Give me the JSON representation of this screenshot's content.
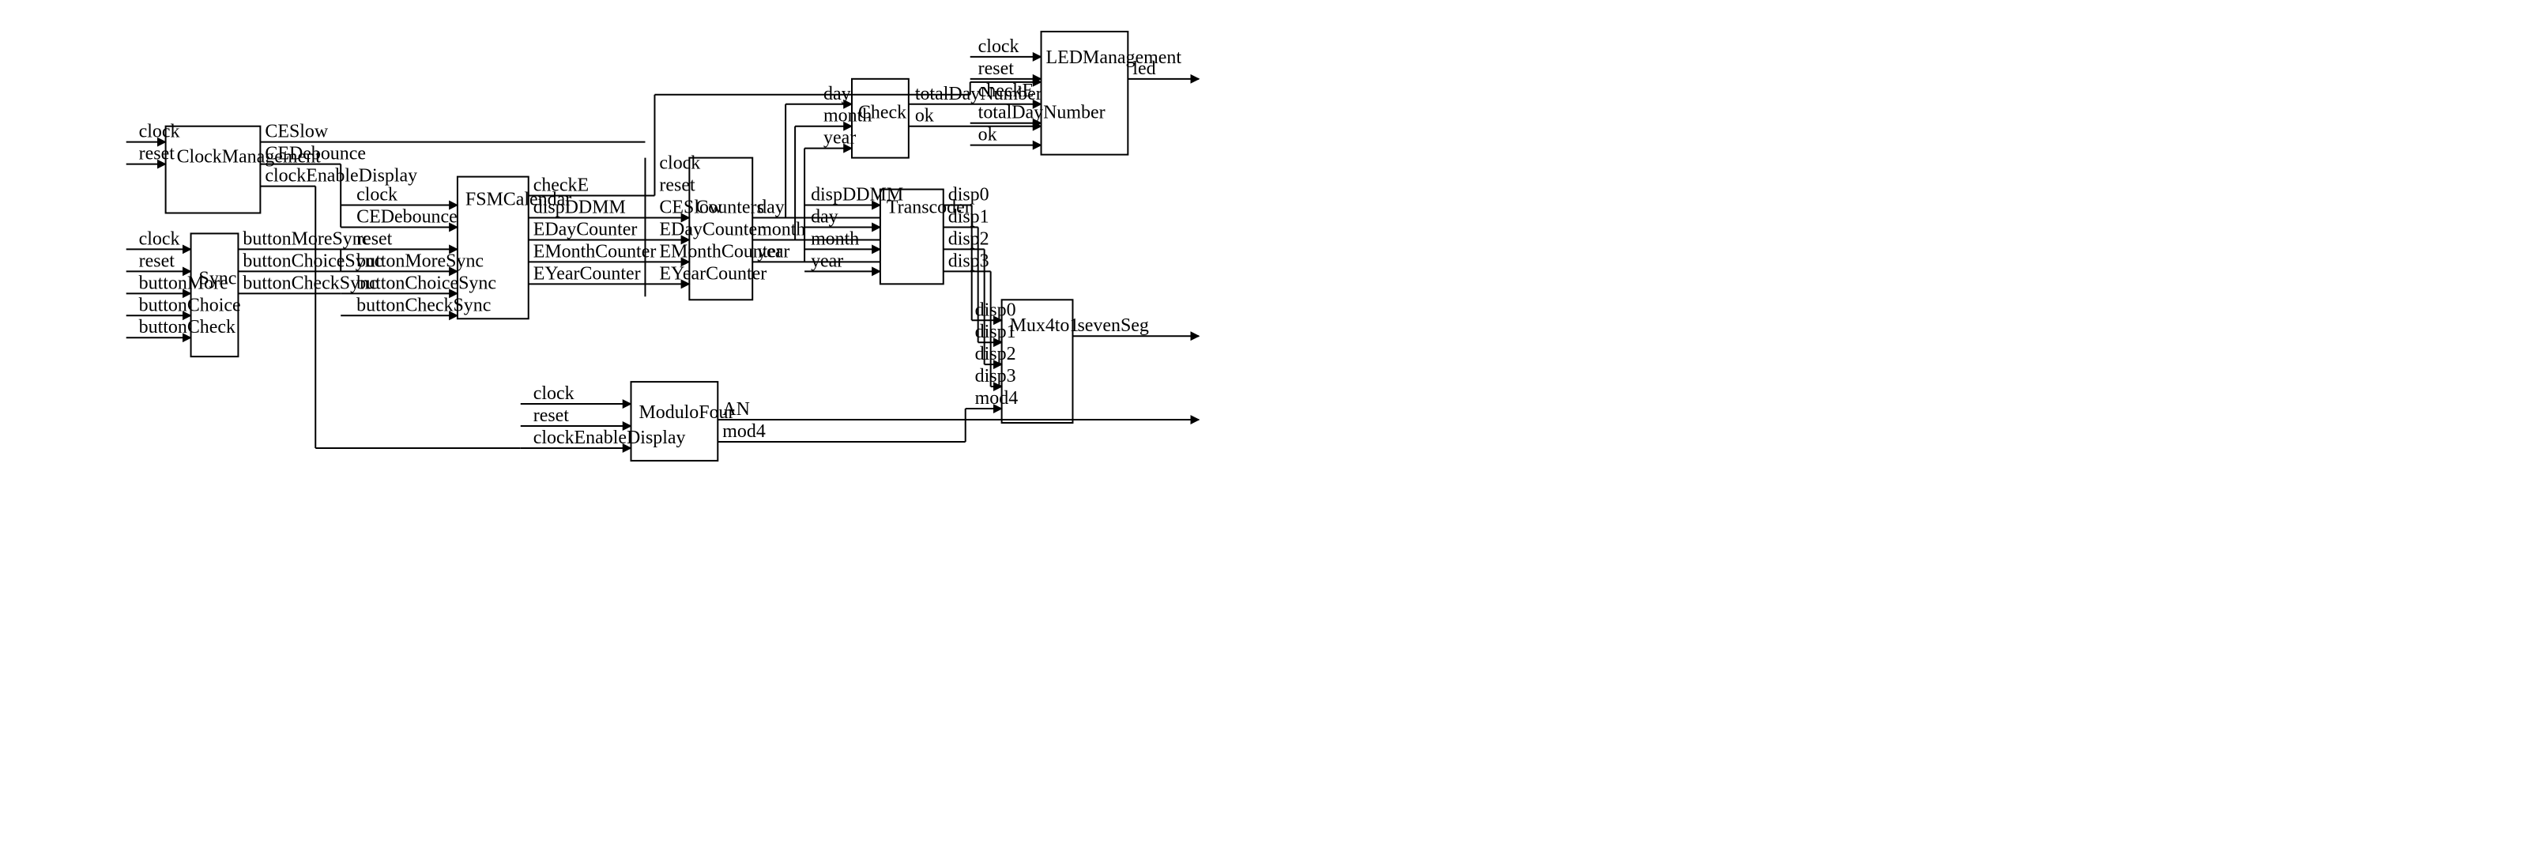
{
  "blocks": {
    "clockMgmt": {
      "name": "ClockManagement",
      "inputs": [
        "clock",
        "reset"
      ],
      "outputs": [
        "CESlow",
        "CEDebounce",
        "clockEnableDisplay"
      ]
    },
    "sync": {
      "name": "Sync",
      "inputs": [
        "clock",
        "reset",
        "buttonMore",
        "buttonChoice",
        "buttonCheck"
      ],
      "outputs": [
        "buttonMoreSync",
        "buttonChoiceSync",
        "buttonCheckSync"
      ]
    },
    "fsm": {
      "name": "FSMCalendar",
      "inputs": [
        "clock",
        "CEDebounce",
        "reset",
        "buttonMoreSync",
        "buttonChoiceSync",
        "buttonCheckSync"
      ],
      "outputs": [
        "checkE",
        "dispDDMM",
        "EDayCounter",
        "EMonthCounter",
        "EYearCounter"
      ]
    },
    "counters": {
      "name": "Counters",
      "inputs": [
        "clock",
        "reset",
        "CESlow",
        "EDayCounter",
        "EMonthCounter",
        "EYearCounter"
      ],
      "outputs": [
        "day",
        "month",
        "year"
      ]
    },
    "check": {
      "name": "Check",
      "inputs": [
        "day",
        "month",
        "year"
      ],
      "outputs": [
        "totalDayNumber",
        "ok"
      ]
    },
    "transcoder": {
      "name": "Transcoder",
      "inputs": [
        "dispDDMM",
        "day",
        "month",
        "year"
      ],
      "outputs": [
        "disp0",
        "disp1",
        "disp2",
        "disp3"
      ]
    },
    "moduloFour": {
      "name": "ModuloFour",
      "inputs": [
        "clock",
        "reset",
        "clockEnableDisplay"
      ],
      "outputs": [
        "AN",
        "mod4"
      ]
    },
    "mux": {
      "name": "Mux4to1",
      "inputs": [
        "disp0",
        "disp1",
        "disp2",
        "disp3",
        "mod4"
      ],
      "outputs": [
        "sevenSeg"
      ]
    },
    "led": {
      "name": "LEDManagement",
      "inputs": [
        "clock",
        "reset",
        "checkE",
        "totalDayNumber",
        "ok"
      ],
      "outputs": [
        "led"
      ]
    }
  }
}
